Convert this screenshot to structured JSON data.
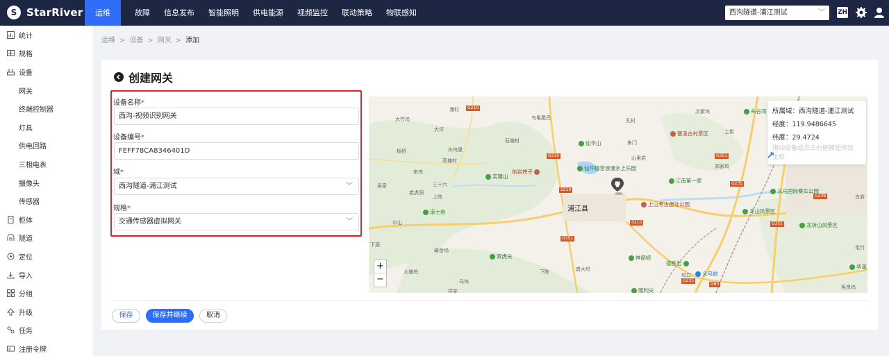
{
  "app": {
    "logo_mark": "S",
    "name": "StarRiver"
  },
  "topnav": {
    "items": [
      "运维",
      "故障",
      "信息发布",
      "智能照明",
      "供电能源",
      "视频监控",
      "联动策略",
      "物联感知"
    ],
    "active_index": 0
  },
  "header": {
    "region_select": "西沟隧道-浦江测试",
    "language": "ZH",
    "settings_icon": "gear-icon",
    "user_icon": "user-icon"
  },
  "sidebar": {
    "items": [
      {
        "label": "统计",
        "icon": "stats-icon"
      },
      {
        "label": "规格",
        "icon": "spec-icon"
      },
      {
        "label": "设备",
        "icon": "device-icon"
      },
      {
        "label": "网关",
        "sub": true
      },
      {
        "label": "终端控制器",
        "sub": true
      },
      {
        "label": "灯具",
        "sub": true
      },
      {
        "label": "供电回路",
        "sub": true
      },
      {
        "label": "三相电表",
        "sub": true
      },
      {
        "label": "摄像头",
        "sub": true
      },
      {
        "label": "传感器",
        "sub": true
      },
      {
        "label": "柜体",
        "icon": "cabinet-icon"
      },
      {
        "label": "隧道",
        "icon": "tunnel-icon"
      },
      {
        "label": "定位",
        "icon": "location-icon"
      },
      {
        "label": "导入",
        "icon": "import-icon"
      },
      {
        "label": "分组",
        "icon": "group-icon"
      },
      {
        "label": "升级",
        "icon": "upgrade-icon"
      },
      {
        "label": "任务",
        "icon": "task-icon"
      },
      {
        "label": "注册令牌",
        "icon": "token-icon"
      }
    ]
  },
  "breadcrumb": [
    "运维",
    "设备",
    "网关",
    "添加"
  ],
  "page": {
    "title": "创建网关"
  },
  "form": {
    "name_label": "设备名称",
    "name_value": "西沟-视频识别网关",
    "code_label": "设备编号",
    "code_value": "FEFF78CA8346401D",
    "domain_label": "域",
    "domain_value": "西沟隧道-浦江测试",
    "spec_label": "规格",
    "spec_value": "交通传感器虚拟网关",
    "required_mark": "*"
  },
  "buttons": {
    "save": "保存",
    "save_continue": "保存并继续",
    "cancel": "取消"
  },
  "map": {
    "info": {
      "domain": "所属域：西沟隧道-浦江测试",
      "lng": "经度：119.9486645",
      "lat": "纬度：29.4724",
      "hint": "拖动设备或点击右侧按钮修改坐标"
    },
    "zoom_in": "+",
    "zoom_out": "−",
    "city": "浦江县",
    "labels": [
      "潘村",
      "乌龟尾巴",
      "孔村",
      "次家坞",
      "布谷湾",
      "大竹坞",
      "大坪",
      "石塘村",
      "仙华山",
      "朱门",
      "上街",
      "板桥",
      "头坞里",
      "高塘村",
      "山里岩",
      "宋坞",
      "吴家",
      "三十六",
      "老虎洞",
      "上阵",
      "中山",
      "下源",
      "破岙坞",
      "大塘坞",
      "马坞",
      "下陈",
      "盛大坞",
      "祥安",
      "坞口",
      "郑家坞",
      "白岩",
      "毛竹",
      "毛良坞"
    ],
    "pois": [
      {
        "name": "仙华山",
        "kind": "green"
      },
      {
        "name": "芙蓉山",
        "kind": "green"
      },
      {
        "name": "佑岩禅寺",
        "kind": "red"
      },
      {
        "name": "仙华檀宫浪漫水上乐园",
        "kind": "green"
      },
      {
        "name": "通济湖",
        "kind": "green"
      },
      {
        "name": "江南第一家",
        "kind": "green"
      },
      {
        "name": "塞溪古村景区",
        "kind": "red"
      },
      {
        "name": "上山考古遗址公园",
        "kind": "red"
      },
      {
        "name": "龙山风景区",
        "kind": "green"
      },
      {
        "name": "义乌国际赛车公园",
        "kind": "green"
      },
      {
        "name": "龙祈山风景区",
        "kind": "green"
      },
      {
        "name": "道士岩",
        "kind": "green"
      },
      {
        "name": "双虎尖",
        "kind": "green"
      },
      {
        "name": "神丽峡",
        "kind": "green"
      },
      {
        "name": "德胜岩",
        "kind": "green"
      },
      {
        "name": "义乌站",
        "kind": "blue"
      },
      {
        "name": "华溪",
        "kind": "green"
      },
      {
        "name": "隆利尖",
        "kind": "green"
      }
    ],
    "road_tags": [
      "G210",
      "G210",
      "S210",
      "S210",
      "G351",
      "G351",
      "G351",
      "G235",
      "G235",
      "G60",
      "G239"
    ]
  }
}
